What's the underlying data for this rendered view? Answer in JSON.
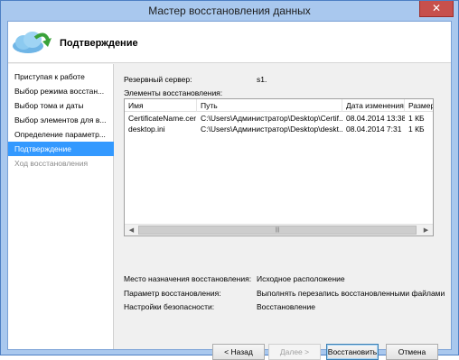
{
  "window": {
    "title": "Мастер восстановления данных",
    "close_label": "✕"
  },
  "header": {
    "title": "Подтверждение",
    "icon": "cloud-restore-icon"
  },
  "sidebar": {
    "items": [
      {
        "label": "Приступая к работе"
      },
      {
        "label": "Выбор режима восстан..."
      },
      {
        "label": "Выбор тома и даты"
      },
      {
        "label": "Выбор элементов для в..."
      },
      {
        "label": "Определение параметр..."
      },
      {
        "label": "Подтверждение"
      },
      {
        "label": "Ход восстановления"
      }
    ]
  },
  "summary": {
    "backup_server_label": "Резервный сервер:",
    "backup_server_value": "s1.",
    "items_label": "Элементы восстановления:"
  },
  "table": {
    "columns": [
      "Имя",
      "Путь",
      "Дата изменения",
      "Размер"
    ],
    "rows": [
      [
        "CertificateName.cer",
        "C:\\Users\\Администратор\\Desktop\\Certif...",
        "08.04.2014 13:38",
        "1 КБ"
      ],
      [
        "desktop.ini",
        "C:\\Users\\Администратор\\Desktop\\deskt...",
        "08.04.2014 7:31",
        "1 КБ"
      ]
    ]
  },
  "details": {
    "destination_label": "Место назначения восстановления:",
    "destination_value": "Исходное расположение",
    "option_label": "Параметр восстановления:",
    "option_value": "Выполнять перезапись восстановленными файлами",
    "security_label": "Настройки безопасности:",
    "security_value": "Восстановление"
  },
  "buttons": {
    "back": "< Назад",
    "next": "Далее >",
    "restore": "Восстановить",
    "cancel": "Отмена"
  }
}
